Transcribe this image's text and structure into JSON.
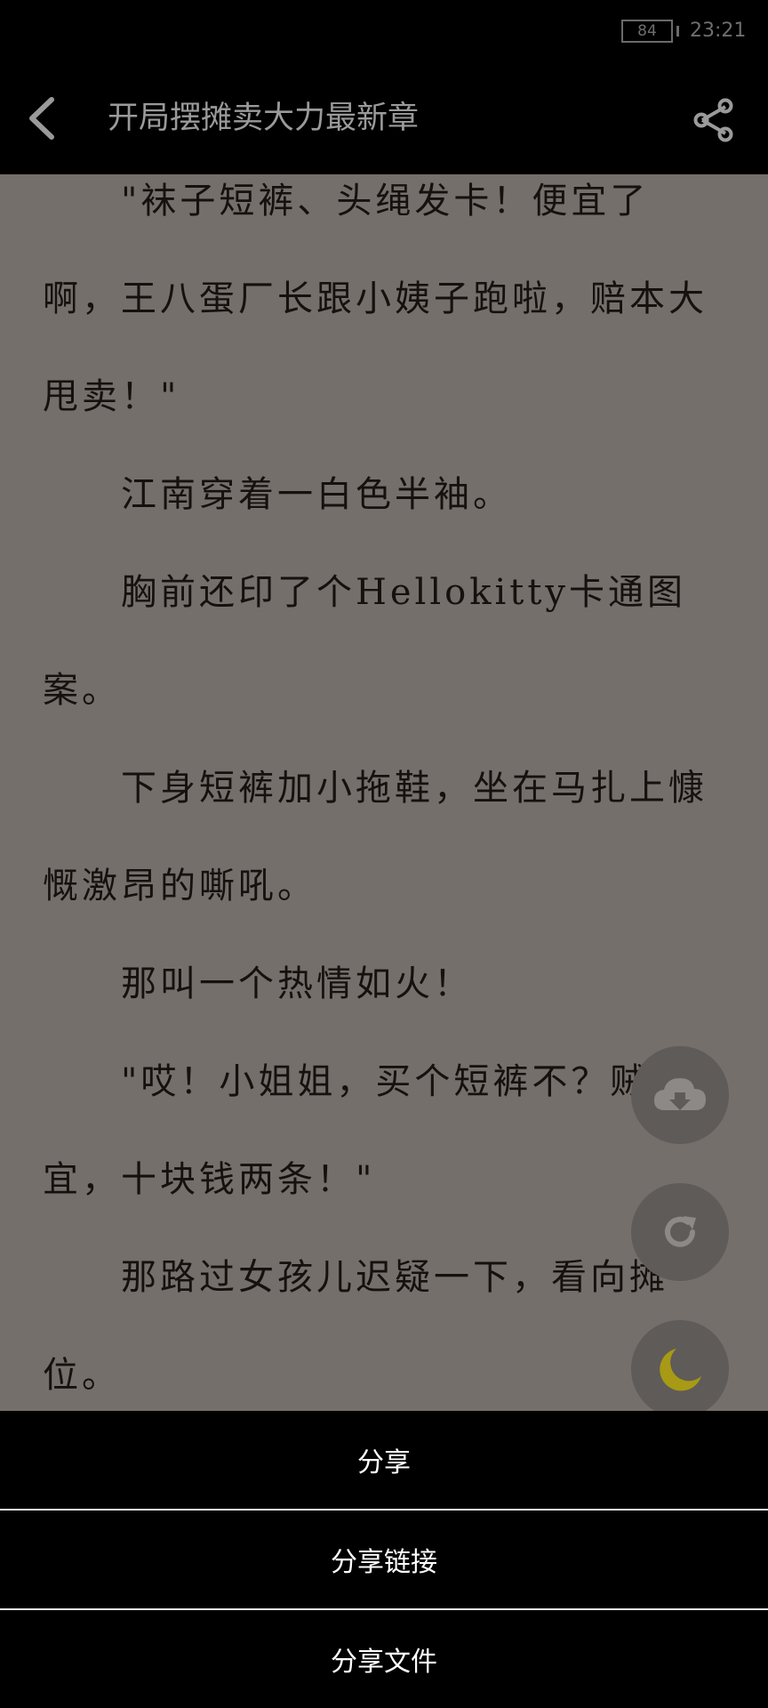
{
  "status_bar": {
    "battery": "84",
    "time": "23:21"
  },
  "header": {
    "title": "开局摆摊卖大力最新章",
    "icons": [
      "back-arrow-icon",
      "share-icon"
    ]
  },
  "content": {
    "paragraphs": [
      "\"袜子短裤、头绳发卡！便宜了啊，王八蛋厂长跟小姨子跑啦，赔本大甩卖！\"",
      "江南穿着一白色半袖。",
      "胸前还印了个Hellokitty卡通图案。",
      "下身短裤加小拖鞋，坐在马扎上慷慨激昂的嘶吼。",
      "那叫一个热情如火！",
      "\"哎！小姐姐，买个短裤不？贼便宜，十块钱两条！\"",
      "那路过女孩儿迟疑一下，看向摊位。"
    ]
  },
  "floating_actions": [
    "cloud-download-icon",
    "refresh-icon",
    "night-mode-moon-icon"
  ],
  "share_sheet": {
    "items": [
      "分享",
      "分享链接",
      "分享文件"
    ]
  },
  "colors": {
    "reader_background": "#756f6b",
    "text": "#15110e",
    "sheet_background": "#000000",
    "moon_accent": "#a89a14"
  }
}
